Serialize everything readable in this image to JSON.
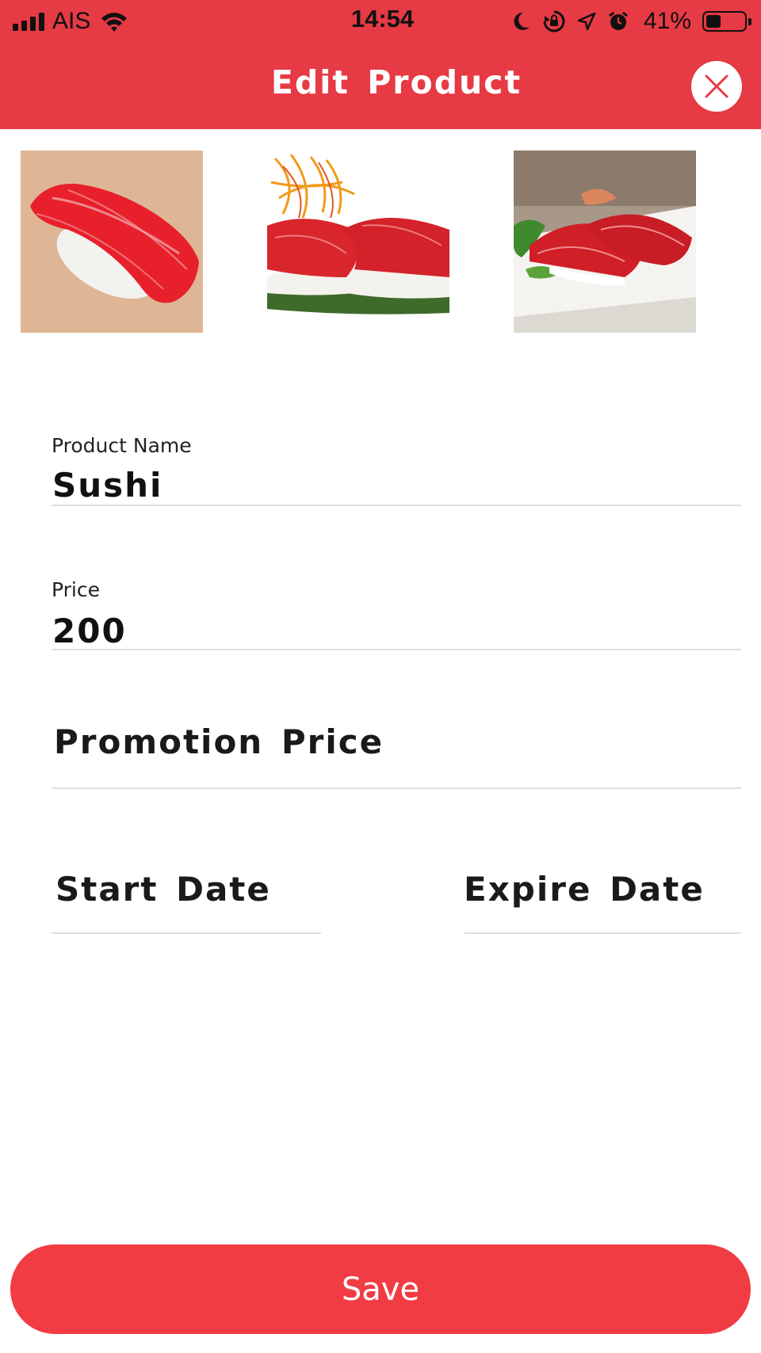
{
  "colors": {
    "header_bg": "#e63a44",
    "save_bg": "#f23c43",
    "close_x": "#e63a44"
  },
  "status_bar": {
    "carrier": "AIS",
    "time": "14:54",
    "battery_percent": "41%",
    "battery_level": 0.41,
    "icons": [
      "signal-icon",
      "wifi-icon",
      "moon-icon",
      "rotation-lock-icon",
      "location-icon",
      "alarm-icon",
      "battery-icon"
    ]
  },
  "header": {
    "title": "Edit Product",
    "close_icon": "close-icon"
  },
  "images": [
    {
      "name": "sushi-photo-1"
    },
    {
      "name": "sushi-photo-2"
    },
    {
      "name": "sushi-photo-3"
    }
  ],
  "form": {
    "product_name": {
      "label": "Product Name",
      "value": "Sushi"
    },
    "price": {
      "label": "Price",
      "value": "200"
    },
    "promotion_price": {
      "placeholder": "Promotion Price"
    },
    "start_date": {
      "placeholder": "Start Date"
    },
    "expire_date": {
      "placeholder": "Expire Date"
    }
  },
  "save_button": {
    "label": "Save"
  }
}
